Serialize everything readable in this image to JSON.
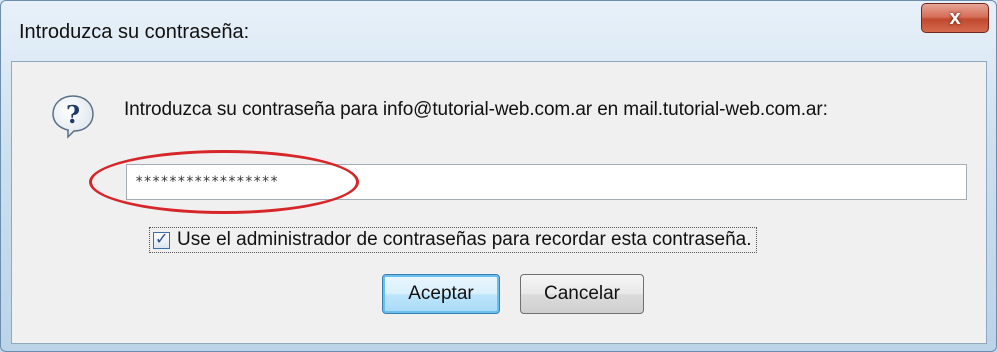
{
  "window": {
    "title": "Introduzca su contraseña:",
    "close_label": "x"
  },
  "dialog": {
    "icon": "help-question-icon",
    "message": "Introduzca su contraseña para info@tutorial-web.com.ar en mail.tutorial-web.com.ar:",
    "password_value": "*****************",
    "remember": {
      "checked": true,
      "label": "Use el administrador de contraseñas para recordar esta contraseña."
    },
    "buttons": {
      "accept": "Aceptar",
      "cancel": "Cancelar"
    }
  },
  "colors": {
    "highlight": "#d6262a",
    "close_button": "#c04a2e",
    "default_button_border": "#3c7fb1"
  }
}
